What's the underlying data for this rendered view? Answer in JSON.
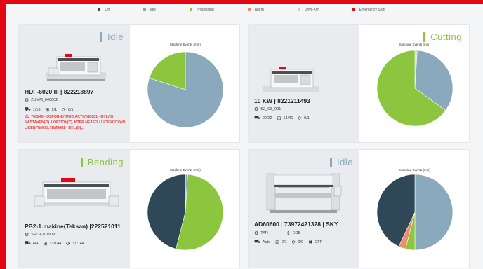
{
  "legend": [
    {
      "label": "Off",
      "color": "#2f4858"
    },
    {
      "label": "Idle",
      "color": "#8aa9bd"
    },
    {
      "label": "Processing",
      "color": "#8cc63f"
    },
    {
      "label": "Alarm",
      "color": "#f08c6c"
    },
    {
      "label": "Drive-Off",
      "color": "#c8cdd2"
    },
    {
      "label": "Emergency Stop",
      "color": "#e30613"
    }
  ],
  "cards": [
    {
      "status": "Idle",
      "status_color": "#8aa9bd",
      "name": "HDF-6020 III | 822218897",
      "program": "ZUMM_040002",
      "parts": "1/16",
      "sheets": "1/1",
      "cycles": "0/1",
      "alarm": "700240 - USPORNY MOD AKTIVNI8081 - BYL(O) NASTAVEN(O) 1 OPTION(Y), KTER NEJSOU LICENCOVAN LICENYNM KL?EM8081 - BYL(O)...",
      "chart_title": "Machine Events (min)",
      "icon": "laser-machine-icon"
    },
    {
      "status": "Cutting",
      "status_color": "#8cc63f",
      "name": "10 KW | 8221211493",
      "program": "S2_C8_001",
      "parts": "20/22",
      "sheets": "14/46",
      "cycles": "0/1",
      "chart_title": "Machine Events (min)",
      "icon": "laser-machine-icon"
    },
    {
      "status": "Bending",
      "status_color": "#8cc63f",
      "name": "PB2-1.makine(Teksan) |222521011",
      "program": "SP-14101909...",
      "parts": "4/4",
      "sheets": "31/144",
      "cycles": "31/144",
      "chart_title": "Machine Events (min)",
      "icon": "press-brake-icon"
    },
    {
      "status": "Idle",
      "status_color": "#8aa9bd",
      "name": "AD60600 | 73972421328 | SKY",
      "program": "TAR",
      "program2": "EOB",
      "parts": "Auto",
      "sheets": "0/1",
      "cycles": "0/0",
      "extra": "OFF",
      "chart_title": "Machine Events (min)",
      "icon": "press-brake-icon"
    }
  ],
  "chart_data": [
    {
      "type": "pie",
      "title": "Machine Events (min)",
      "labels": [
        "Idle",
        "Processing"
      ],
      "values": [
        80,
        20
      ],
      "colors": [
        "#8aa9bd",
        "#8cc63f"
      ]
    },
    {
      "type": "pie",
      "title": "Machine Events (min)",
      "labels": [
        "Drive-Off",
        "Idle",
        "Processing"
      ],
      "values": [
        1,
        34,
        65
      ],
      "colors": [
        "#c8cdd2",
        "#8aa9bd",
        "#8cc63f"
      ]
    },
    {
      "type": "pie",
      "title": "Machine Events (min)",
      "labels": [
        "Idle",
        "Processing",
        "Off"
      ],
      "values": [
        1,
        53,
        46
      ],
      "colors": [
        "#8aa9bd",
        "#8cc63f",
        "#2f4858"
      ]
    },
    {
      "type": "pie",
      "title": "Machine Events (min)",
      "labels": [
        "Idle",
        "Processing",
        "Alarm",
        "Off"
      ],
      "values": [
        50,
        4,
        3,
        43
      ],
      "colors": [
        "#8aa9bd",
        "#8cc63f",
        "#f08c6c",
        "#2f4858"
      ]
    }
  ]
}
